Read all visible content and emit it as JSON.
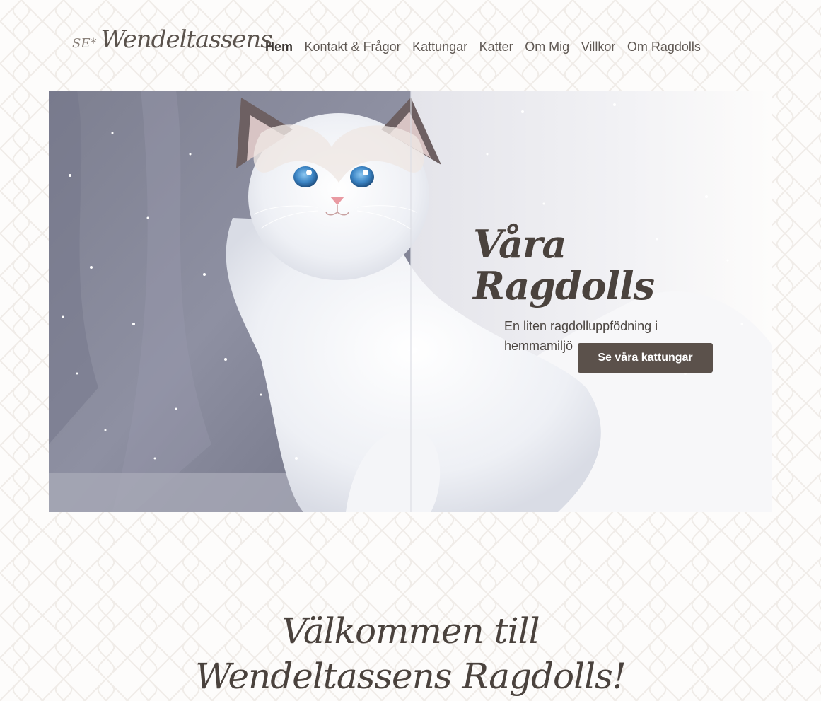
{
  "header": {
    "logo_prefix": "SE*",
    "logo_text": "Wendeltassens"
  },
  "nav": {
    "items": [
      {
        "label": "Hem",
        "active": true
      },
      {
        "label": "Kontakt & Frågor"
      },
      {
        "label": "Kattungar"
      },
      {
        "label": "Katter"
      },
      {
        "label": "Om Mig"
      },
      {
        "label": "Villkor"
      },
      {
        "label": "Om Ragdolls"
      }
    ]
  },
  "hero": {
    "title": "Våra Ragdolls",
    "subtitle": "En liten ragdolluppfödning i hemmamiljö",
    "button_label": "Se våra kattungar",
    "button_color": "#5b514b"
  },
  "welcome": {
    "line1": "Välkommen till",
    "line2": "Wendeltassens Ragdolls!"
  }
}
